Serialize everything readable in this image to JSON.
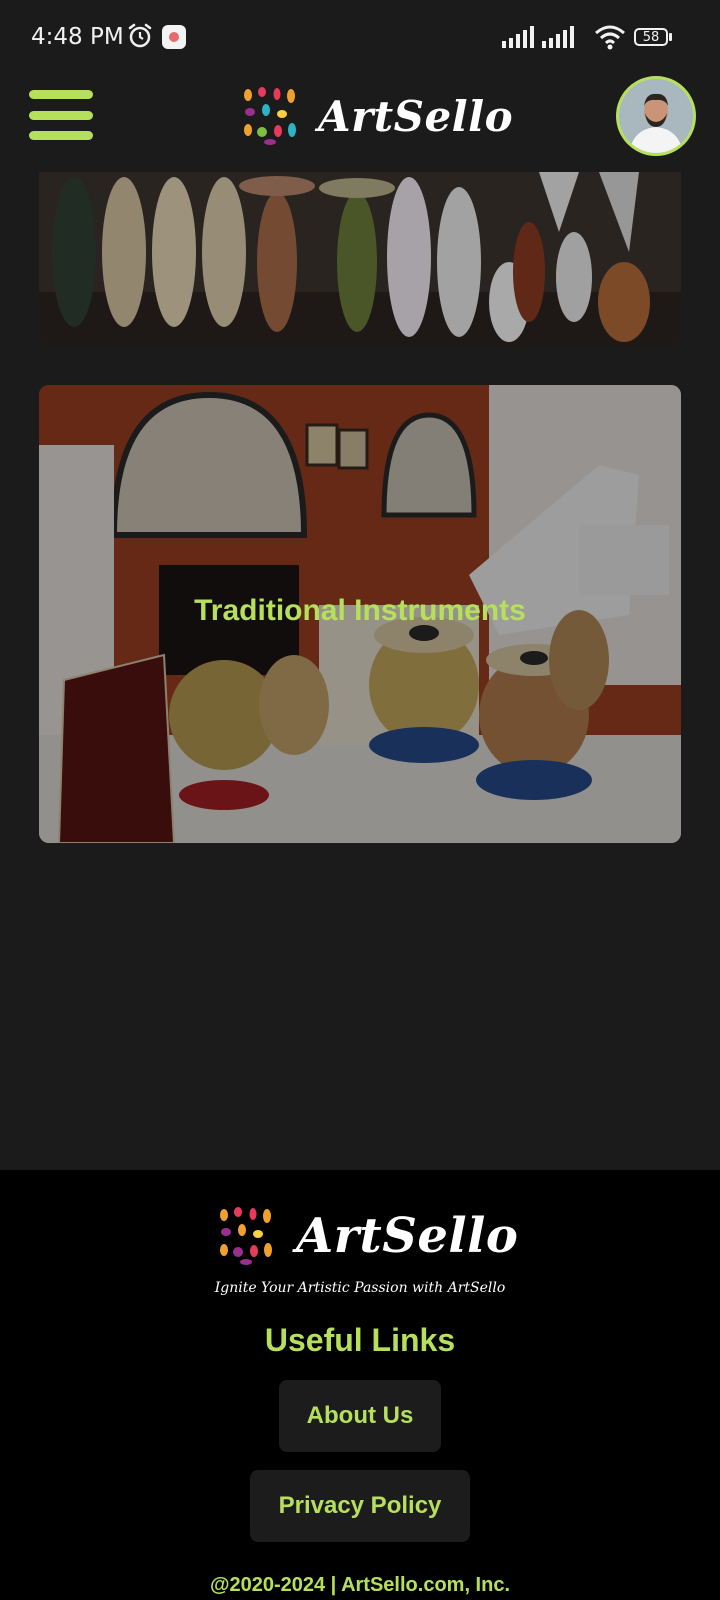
{
  "status_bar": {
    "time": "4:48 PM",
    "battery": "58",
    "icons": [
      "alarm-icon",
      "notification-app-icon",
      "signal-icon",
      "signal-icon",
      "wifi-icon",
      "battery-icon"
    ]
  },
  "header": {
    "brand": "ArtSello",
    "menu_icon": "hamburger-menu-icon",
    "avatar_icon": "user-avatar"
  },
  "categories": [
    {
      "title": "",
      "image": "sculptures-photo"
    },
    {
      "title": "Traditional Instruments",
      "image": "instruments-photo"
    }
  ],
  "footer": {
    "brand": "ArtSello",
    "tagline": "Ignite Your Artistic Passion with ArtSello",
    "useful_links_heading": "Useful Links",
    "links": [
      "About Us",
      "Privacy Policy"
    ],
    "copyright": "@2020-2024 | ArtSello.com, Inc."
  },
  "colors": {
    "accent": "#b6e05c",
    "background": "#1b1b1b",
    "footer_background": "#000000",
    "button_background": "#1c1c1c"
  }
}
